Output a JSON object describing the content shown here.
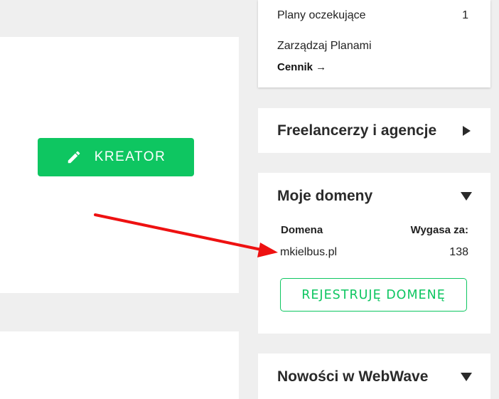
{
  "editor": {
    "kreator_label": "KREATOR"
  },
  "plans": {
    "pending_label": "Plany oczekujące",
    "pending_count": "1",
    "manage_label": "Zarządzaj Planami",
    "pricing_label": "Cennik →"
  },
  "freelancers": {
    "title": "Freelancerzy i agencje",
    "toggle_icon": "triangle-right-icon"
  },
  "domains": {
    "title": "Moje domeny",
    "toggle_icon": "triangle-down-icon",
    "columns": [
      "Domena",
      "Wygasa za:"
    ],
    "rows": [
      {
        "domain": "mkielbus.pl",
        "expires": "138"
      }
    ],
    "register_label": "REJESTRUJĘ DOMENĘ"
  },
  "news": {
    "title": "Nowości w WebWave",
    "toggle_icon": "triangle-down-icon"
  },
  "colors": {
    "accent_green": "#0ec661",
    "annotation_red": "#ee1111",
    "background": "#efefef"
  }
}
